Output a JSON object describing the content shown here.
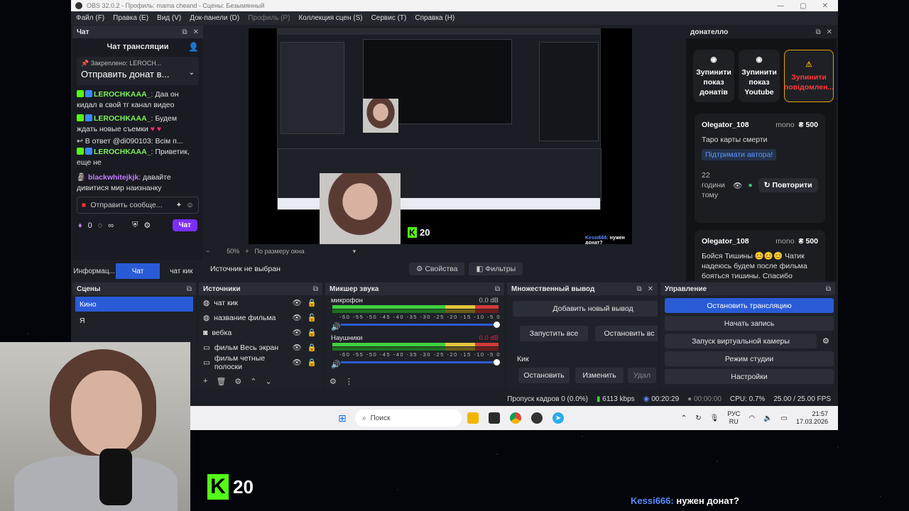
{
  "titlebar": {
    "title": "OBS 32.0.2 - Профиль: mama cheand - Сцены: Безымянный"
  },
  "menu": [
    "Файл (F)",
    "Правка (E)",
    "Вид (V)",
    "Док-панели (D)",
    "Профиль (P)",
    "Коллекция сцен (S)",
    "Сервис (T)",
    "Справка (H)"
  ],
  "chat": {
    "dock_title": "Чат",
    "header": "Чат трансляции",
    "pinned_label": "Закреплено:",
    "pinned_user": "LEROCH...",
    "pinned_text": "Отправить донат в...",
    "messages": [
      {
        "nick": "LEROCHKAAA_",
        "text": ": Даа он кидал в свой тг канал видео"
      },
      {
        "nick": "LEROCHKAAA_",
        "text": ": Будем ждать новые съемки"
      },
      {
        "reply": "В ответ @di090103: Всім п..."
      },
      {
        "nick": "LEROCHKAAA_",
        "text": ": Приветик, еще не"
      },
      {
        "nick2": "blackwhitejkjk",
        "text": ": давайте дивитися мир наизнанку"
      }
    ],
    "input_placeholder": "Отправить сообще...",
    "points": "0",
    "infinity": "∞",
    "chat_button": "Чат",
    "tabs": [
      "Информац...",
      "Чат",
      "чат кик"
    ]
  },
  "preview": {
    "zoom": "50%",
    "fit": "По размеру окна",
    "k_count": "20",
    "overlay_msg_nick": "Kessi666:",
    "overlay_msg_text": "нужен донат?"
  },
  "propbar": {
    "source": "Источник не выбран",
    "properties": "Свойства",
    "filters": "Фильтры"
  },
  "donatello": {
    "dock_title": "донателло",
    "buttons": [
      "Зупинити показ донатів",
      "Зупинити показ Youtube",
      "Зупинити повідомлен..."
    ],
    "cards": [
      {
        "user": "Olegator_108",
        "platform": "mono",
        "amount": "₴ 500",
        "message": "Таро карты смерти",
        "support": "Підтримати автора!",
        "ago": "22 години тому",
        "repeat": "Повторити"
      },
      {
        "user": "Olegator_108",
        "platform": "mono",
        "amount": "₴ 500",
        "message": "Бойся Тишины 😊😊😊 Чатик надеюсь будем после фильма бояться тишины. Спасибо",
        "support": "",
        "ago": "",
        "repeat": ""
      }
    ]
  },
  "scenes": {
    "dock_title": "Сцены",
    "items": [
      "Кино",
      "Я"
    ]
  },
  "sources": {
    "dock_title": "Источники",
    "items": [
      "чат кик",
      "название фильма",
      "вебка",
      "фильм Весь экран",
      "фильм четные полоски"
    ]
  },
  "mixer": {
    "dock_title": "Микшер звука",
    "channels": [
      {
        "name": "микрофон",
        "db": "0.0 dB"
      },
      {
        "name": "Наушники",
        "db": "0.0 dB"
      }
    ],
    "scale": "-60 -55 -50 -45 -40 -35 -30 -25 -20 -15 -10 -5 0"
  },
  "multi_output": {
    "dock_title": "Множественный вывод",
    "add": "Добавить новый вывод",
    "start_all": "Запустить все",
    "stop_all": "Остановить вс",
    "target": "Кик",
    "stop": "Остановить",
    "edit": "Изменить",
    "delete": "Удал"
  },
  "controls": {
    "dock_title": "Управление",
    "buttons": [
      "Остановить трансляцию",
      "Начать запись",
      "Запуск виртуальной камеры",
      "Режим студии",
      "Настройки"
    ]
  },
  "status": {
    "dropped": "Пропуск кадров 0 (0.0%)",
    "kbps": "6113 kbps",
    "live_time": "00:20:29",
    "rec_time": "00:00:00",
    "cpu": "CPU: 0.7%",
    "fps": "25.00 / 25.00 FPS"
  },
  "taskbar": {
    "search": "Поиск",
    "lang1": "РУС",
    "lang2": "RU",
    "time": "21:57",
    "date": "17.03.2026"
  },
  "stream_overlay": {
    "k_count": "20",
    "nick": "Kessi666:",
    "text": "нужен донат?"
  }
}
